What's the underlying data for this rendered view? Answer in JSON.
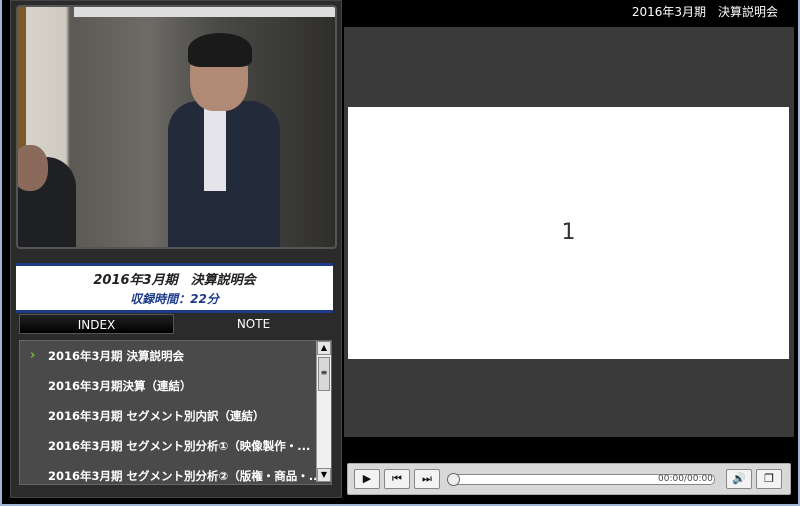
{
  "header": {
    "title": "2016年3月期　決算説明会"
  },
  "video": {
    "subject": "presenter-video"
  },
  "info": {
    "title": "2016年3月期　決算説明会",
    "duration": "収録時間：22分"
  },
  "tabs": [
    {
      "label": "INDEX",
      "active": true
    },
    {
      "label": "NOTE",
      "active": false
    }
  ],
  "index_items": [
    {
      "label": "2016年3月期 決算説明会",
      "current": true
    },
    {
      "label": "2016年3月期決算（連結）"
    },
    {
      "label": "2016年3月期 セグメント別内訳（連結）"
    },
    {
      "label": "2016年3月期 セグメント別分析①（映像製作・..."
    },
    {
      "label": "2016年3月期 セグメント別分析②（版権・商品・..."
    }
  ],
  "slide": {
    "page_number": "1"
  },
  "player": {
    "time": "00:00/00:00",
    "progress": 0
  },
  "colors": {
    "accent": "#1d3b8a",
    "current_marker": "#6ec23a"
  }
}
